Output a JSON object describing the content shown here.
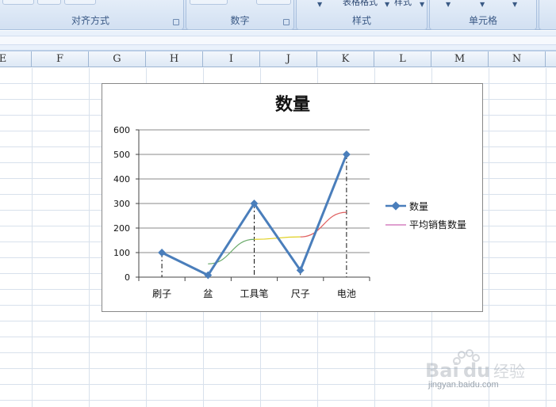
{
  "ribbon": {
    "groups": [
      {
        "label": "对齐方式"
      },
      {
        "label": "数字"
      },
      {
        "label": "样式",
        "buttons": [
          "表格格式",
          "样式"
        ]
      },
      {
        "label": "单元格"
      }
    ]
  },
  "columns": [
    "E",
    "F",
    "G",
    "H",
    "I",
    "J",
    "K",
    "L",
    "M",
    "N"
  ],
  "chart_data": {
    "type": "line",
    "title": "数量",
    "categories": [
      "刷子",
      "盆",
      "工具笔",
      "尺子",
      "电池"
    ],
    "ylim": [
      0,
      600
    ],
    "yticks": [
      "0",
      "100",
      "200",
      "300",
      "400",
      "500",
      "600"
    ],
    "grid": true,
    "legend_position": "right",
    "series": [
      {
        "name": "数量",
        "values": [
          100,
          8,
          300,
          28,
          500
        ],
        "color": "#4a7ebb",
        "marker": "diamond"
      },
      {
        "name": "平均销售数量",
        "values": [
          null,
          54,
          154,
          164,
          264
        ],
        "color": "#c040a0",
        "segment_colors": [
          "#6aaa6a",
          "#e0d020",
          "#e06060"
        ]
      }
    ],
    "drop_lines": true
  },
  "watermark": {
    "logo": "Baidu经验",
    "url": "jingyan.baidu.com"
  }
}
